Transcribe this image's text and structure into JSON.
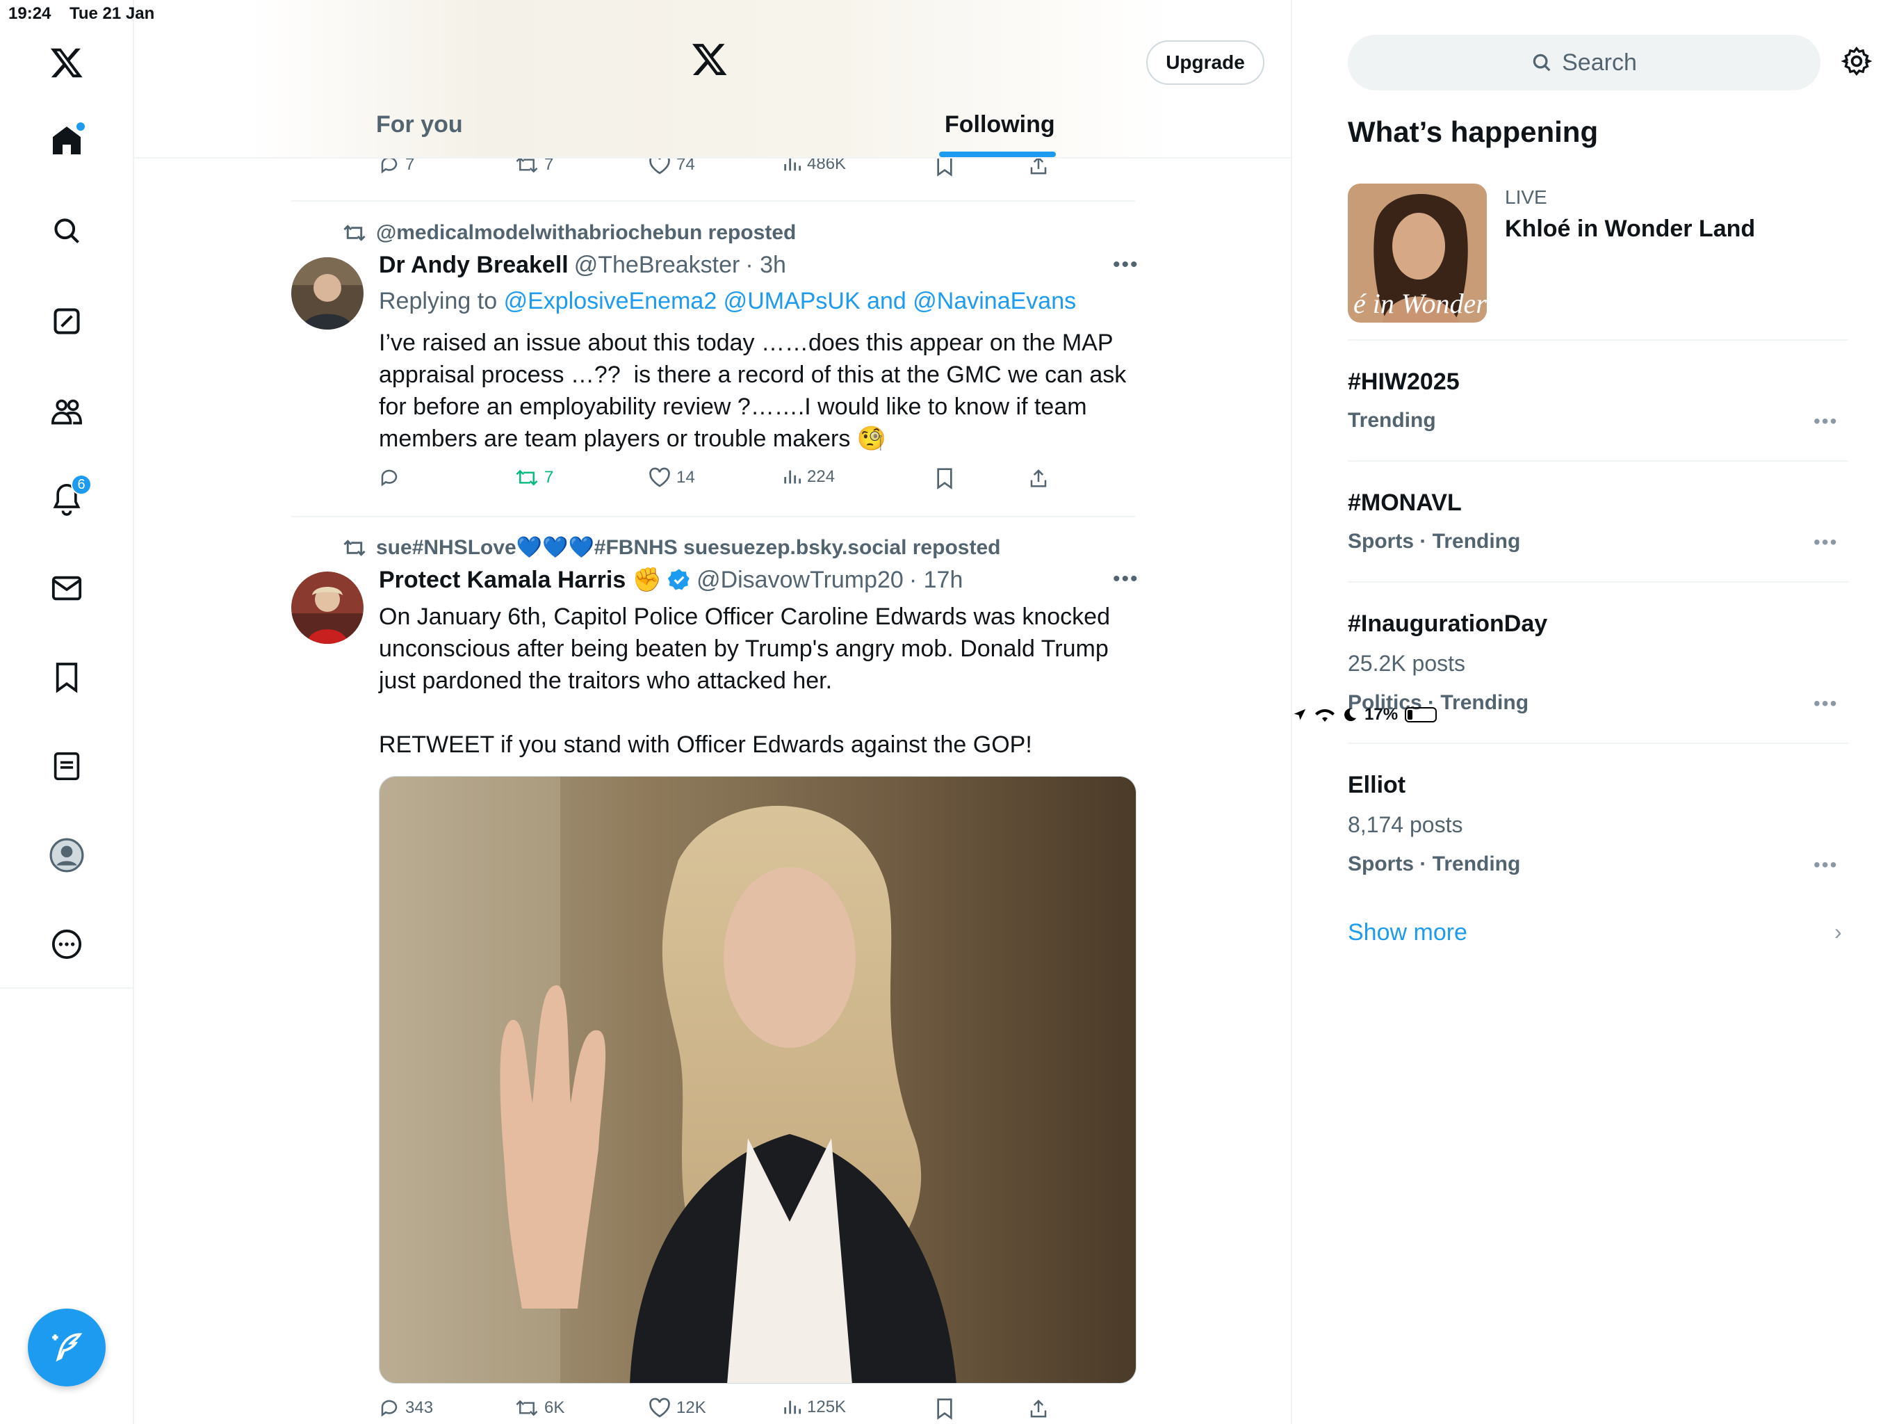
{
  "status_bar": {
    "time": "19:24",
    "date": "Tue 21 Jan",
    "battery": "17%"
  },
  "nav": {
    "notifications_badge": "6"
  },
  "header": {
    "upgrade_label": "Upgrade",
    "tabs": [
      "For you",
      "Following"
    ],
    "active_tab": "Following"
  },
  "top_actions": {
    "replies": "7",
    "reposts": "7",
    "likes": "74",
    "views": "486K"
  },
  "tweets": [
    {
      "reposted_by": "@medicalmodelwithabriochebun reposted",
      "name": "Dr Andy Breakell",
      "handle": "@TheBreakster",
      "time": "· 3h",
      "replying_prefix": "Replying to",
      "replying_to": "@ExplosiveEnema2 @UMAPsUK and @NavinaEvans",
      "text": "I’ve raised an issue about this today ……does this appear on the MAP appraisal process …??  is there a record of this at the GMC we can ask for before an employability review ?…….I would like to know if team members are team players or trouble makers 🧐",
      "replies": "",
      "reposts": "7",
      "likes": "14",
      "views": "224"
    },
    {
      "reposted_by": "sue#NHSLove💙💙💙#FBNHS suesuezep.bsky.social reposted",
      "name": "Protect Kamala Harris ✊",
      "handle": "@DisavowTrump20",
      "time": "· 17h",
      "text": "On January 6th, Capitol Police Officer Caroline Edwards was knocked unconscious after being beaten by Trump's angry mob. Donald Trump just pardoned the traitors who attacked her.\n\nRETWEET if you stand with Officer Edwards against the GOP!",
      "replies": "343",
      "reposts": "6K",
      "likes": "12K",
      "views": "125K"
    }
  ],
  "sidebar": {
    "search_placeholder": "Search",
    "heading": "What’s happening",
    "live": {
      "label": "LIVE",
      "title": "Khloé in Wonder Land",
      "thumb_text": "é in Wonder I"
    },
    "trends": [
      {
        "title": "#HIW2025",
        "posts": "",
        "meta": "Trending"
      },
      {
        "title": "#MONAVL",
        "posts": "",
        "meta": "Sports · Trending"
      },
      {
        "title": "#InaugurationDay",
        "posts": "25.2K posts",
        "meta": "Politics · Trending"
      },
      {
        "title": "Elliot",
        "posts": "8,174 posts",
        "meta": "Sports · Trending"
      }
    ],
    "show_more": "Show more"
  },
  "colors": {
    "accent": "#1d9bf0",
    "repost_green": "#00ba7c",
    "text_secondary": "#536471"
  }
}
